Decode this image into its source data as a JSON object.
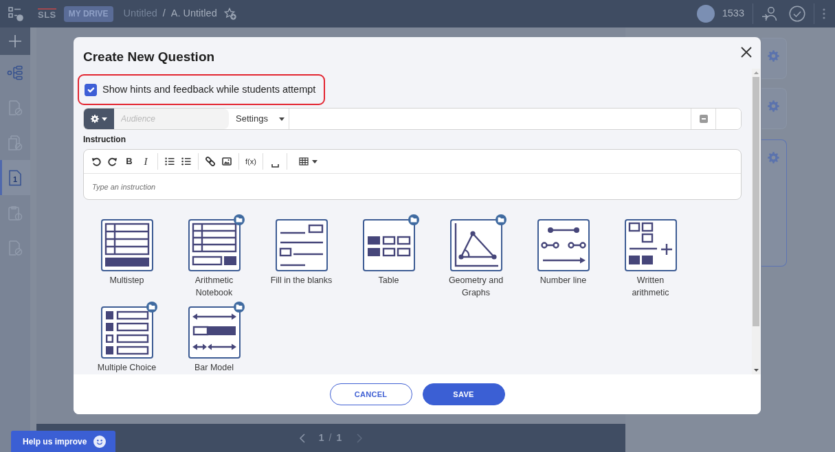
{
  "top_bar": {
    "logo": "SLS",
    "drive_badge": "MY DRIVE",
    "breadcrumb": [
      {
        "label": "Untitled",
        "current": false
      },
      {
        "label": "A. Untitled",
        "current": true
      }
    ],
    "separator": "/",
    "points": "1533"
  },
  "sidebar": {
    "items": [
      {
        "kind": "hierarchy",
        "selected": false,
        "disabled": false
      },
      {
        "kind": "document",
        "selected": false,
        "disabled": true
      },
      {
        "kind": "folder",
        "selected": false,
        "disabled": true
      },
      {
        "kind": "page",
        "label": "1",
        "selected": true,
        "disabled": false
      },
      {
        "kind": "clipboard",
        "selected": false,
        "disabled": true
      },
      {
        "kind": "document",
        "selected": false,
        "disabled": true
      }
    ]
  },
  "side_panels": [
    {
      "selected": false
    },
    {
      "selected": false
    },
    {
      "selected": true
    }
  ],
  "pager": {
    "current": "1",
    "separator": "/",
    "total": "1",
    "next_disabled": true
  },
  "dialog": {
    "title": "Create New Question",
    "hints_option": {
      "label": "Show hints and feedback while students attempt",
      "checked": true,
      "highlighted": true
    },
    "audience": {
      "placeholder": "Audience"
    },
    "settings_dropdown": {
      "label": "Settings"
    },
    "instruction": {
      "label": "Instruction",
      "placeholder": "Type an instruction"
    },
    "editor_toolbar": [
      {
        "tools": [
          {
            "kind": "undo"
          },
          {
            "kind": "redo"
          },
          {
            "kind": "bold",
            "label": "B"
          },
          {
            "kind": "italic",
            "label": "I"
          }
        ]
      },
      {
        "tools": [
          {
            "kind": "ordered-list"
          },
          {
            "kind": "bullet-list"
          }
        ]
      },
      {
        "tools": [
          {
            "kind": "link"
          },
          {
            "kind": "image"
          }
        ]
      },
      {
        "tools": [
          {
            "kind": "formula",
            "label": "f(x)"
          }
        ]
      },
      {
        "tools": [
          {
            "kind": "blank"
          }
        ]
      },
      {
        "tools": [
          {
            "kind": "table"
          }
        ]
      }
    ],
    "question_types": [
      {
        "label": "Multistep",
        "kind": "multistep",
        "folder_badge": false
      },
      {
        "label": "Arithmetic Notebook",
        "kind": "notebook",
        "folder_badge": true
      },
      {
        "label": "Fill in the blanks",
        "kind": "blanks",
        "folder_badge": false
      },
      {
        "label": "Table",
        "kind": "table",
        "folder_badge": true
      },
      {
        "label": "Geometry and Graphs",
        "kind": "geometry",
        "folder_badge": true
      },
      {
        "label": "Number line",
        "kind": "number-line",
        "folder_badge": false
      },
      {
        "label": "Written arithmetic",
        "kind": "written-arithmetic",
        "folder_badge": false
      },
      {
        "label": "Multiple Choice",
        "kind": "multiple-choice",
        "folder_badge": true
      },
      {
        "label": "Bar Model",
        "kind": "bar-model",
        "folder_badge": true
      }
    ],
    "buttons": [
      {
        "label": "CANCEL",
        "kind": "outline"
      },
      {
        "label": "SAVE",
        "kind": "primary"
      }
    ]
  },
  "help_button": {
    "label": "Help us improve"
  }
}
